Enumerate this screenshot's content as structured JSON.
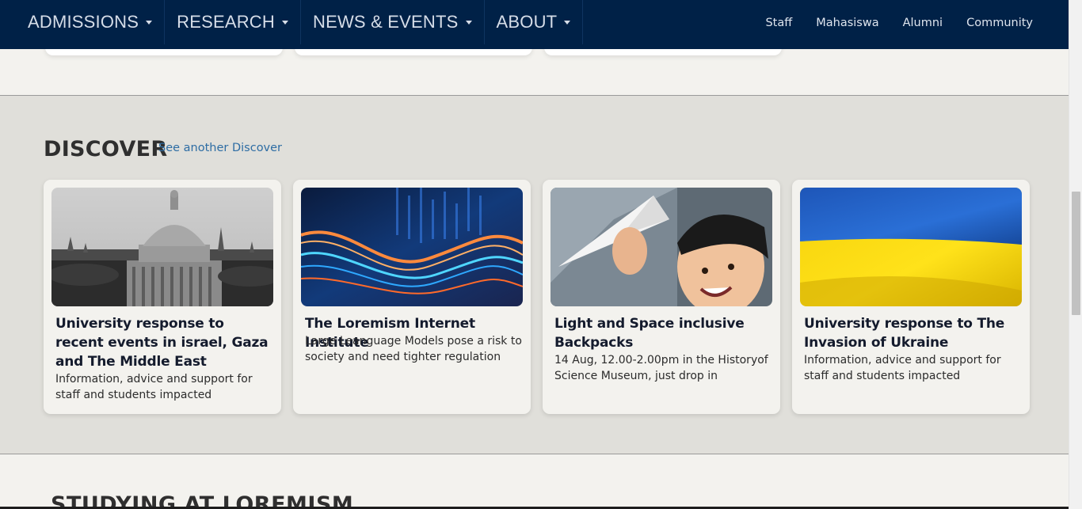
{
  "nav": {
    "main": [
      {
        "label": "ADMISSIONS"
      },
      {
        "label": "RESEARCH"
      },
      {
        "label": "NEWS & EVENTS"
      },
      {
        "label": "ABOUT"
      }
    ],
    "right": [
      "Staff",
      "Mahasiswa",
      "Alumni",
      "Community"
    ]
  },
  "discover": {
    "title": "DISCOVER",
    "link": "See another Discover",
    "cards": [
      {
        "title": "University response to recent events in israel, Gaza and The Middle East",
        "desc": "Information, advice and support for staff and students impacted",
        "image": "university-dome-photo"
      },
      {
        "title": "The Loremism Internet Institute",
        "desc": "Large Leanguage Models pose a risk to society and need tighter regulation",
        "image": "digital-wave-photo"
      },
      {
        "title": "Light and Space inclusive Backpacks",
        "desc": "14 Aug, 12.00-2.00pm in the Historyof Science Museum, just drop in",
        "image": "child-paper-plane-photo"
      },
      {
        "title": "University response to The Invasion of Ukraine",
        "desc": "Information, advice and support for staff and students impacted",
        "image": "ukraine-flag-photo"
      }
    ]
  },
  "studying": {
    "title": "STUDYING AT LOREMISM"
  },
  "colors": {
    "nav_bg": "#002147",
    "band_bg": "#e0dfda",
    "page_bg": "#f3f2ee",
    "link": "#2e6da4"
  }
}
